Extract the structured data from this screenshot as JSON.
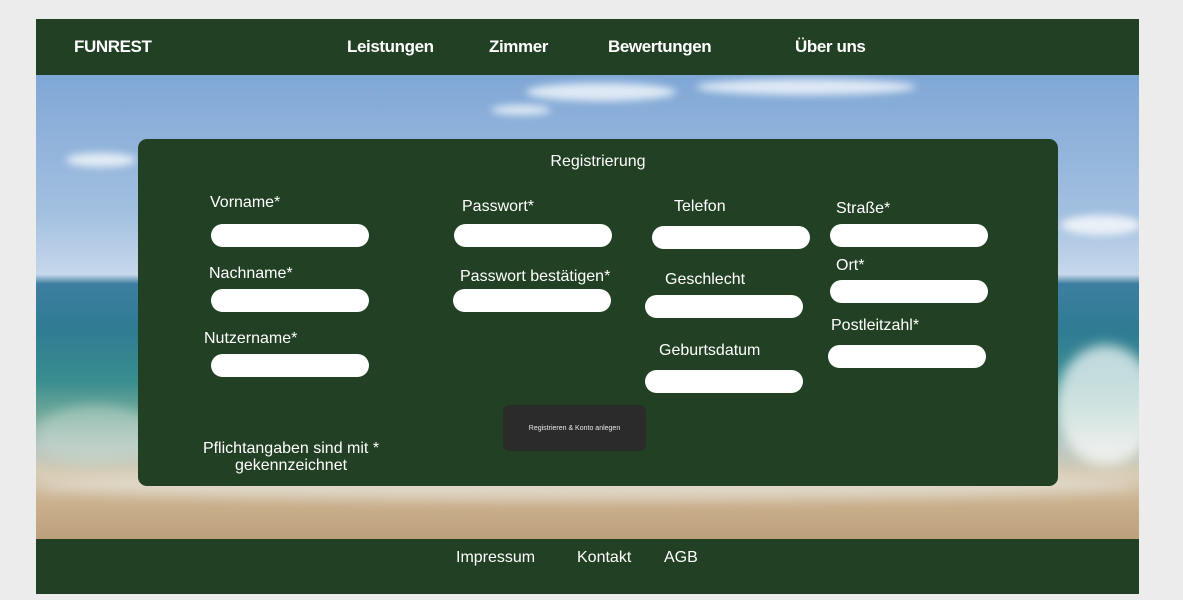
{
  "nav": {
    "brand": "FUNREST",
    "items": [
      "Leistungen",
      "Zimmer",
      "Bewertungen",
      "Über uns"
    ]
  },
  "form": {
    "title": "Registrierung",
    "fields": {
      "vorname": "Vorname*",
      "nachname": "Nachname*",
      "nutzername": "Nutzername*",
      "passwort": "Passwort*",
      "passwort_bestaetigen": "Passwort bestätigen*",
      "telefon": "Telefon",
      "geschlecht": "Geschlecht",
      "geburtsdatum": "Geburtsdatum",
      "strasse": "Straße*",
      "ort": "Ort*",
      "postleitzahl": "Postleitzahl*"
    },
    "submit_label": "Registrieren & Konto anlegen",
    "required_note": "Pflichtangaben sind mit * gekennzeichnet"
  },
  "footer": {
    "links": [
      "Impressum",
      "Kontakt",
      "AGB"
    ]
  },
  "colors": {
    "primary_green": "#224024",
    "button_dark": "#2b2b2b"
  }
}
